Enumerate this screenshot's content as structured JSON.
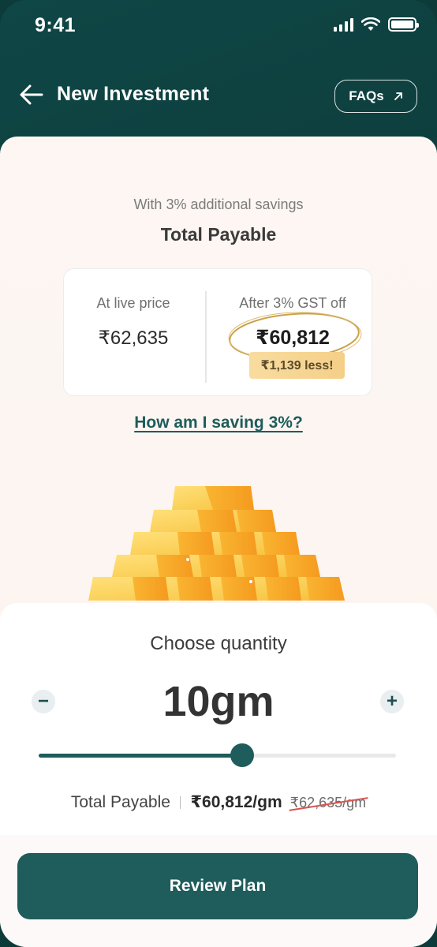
{
  "status_bar": {
    "time": "9:41"
  },
  "header": {
    "title": "New Investment",
    "faqs_label": "FAQs"
  },
  "savings": {
    "note": "With 3% additional savings",
    "title": "Total Payable"
  },
  "price_card": {
    "live_label": "At live price",
    "live_price": "₹62,635",
    "after_label": "After 3% GST off",
    "after_price": "₹60,812",
    "less_badge": "₹1,139 less!"
  },
  "how_link": "How am I saving 3%?",
  "quantity": {
    "title": "Choose quantity",
    "value": "10gm",
    "minus": "−",
    "plus": "+",
    "slider_level": 0.57
  },
  "summary": {
    "label": "Total Payable",
    "price": "₹60,812/gm",
    "old_price": "₹62,635/gm"
  },
  "cta": {
    "review_label": "Review Plan"
  },
  "colors": {
    "primary": "#1f5c5c",
    "header_bg": "#0d3c3b",
    "badge": "#f5cf88"
  }
}
